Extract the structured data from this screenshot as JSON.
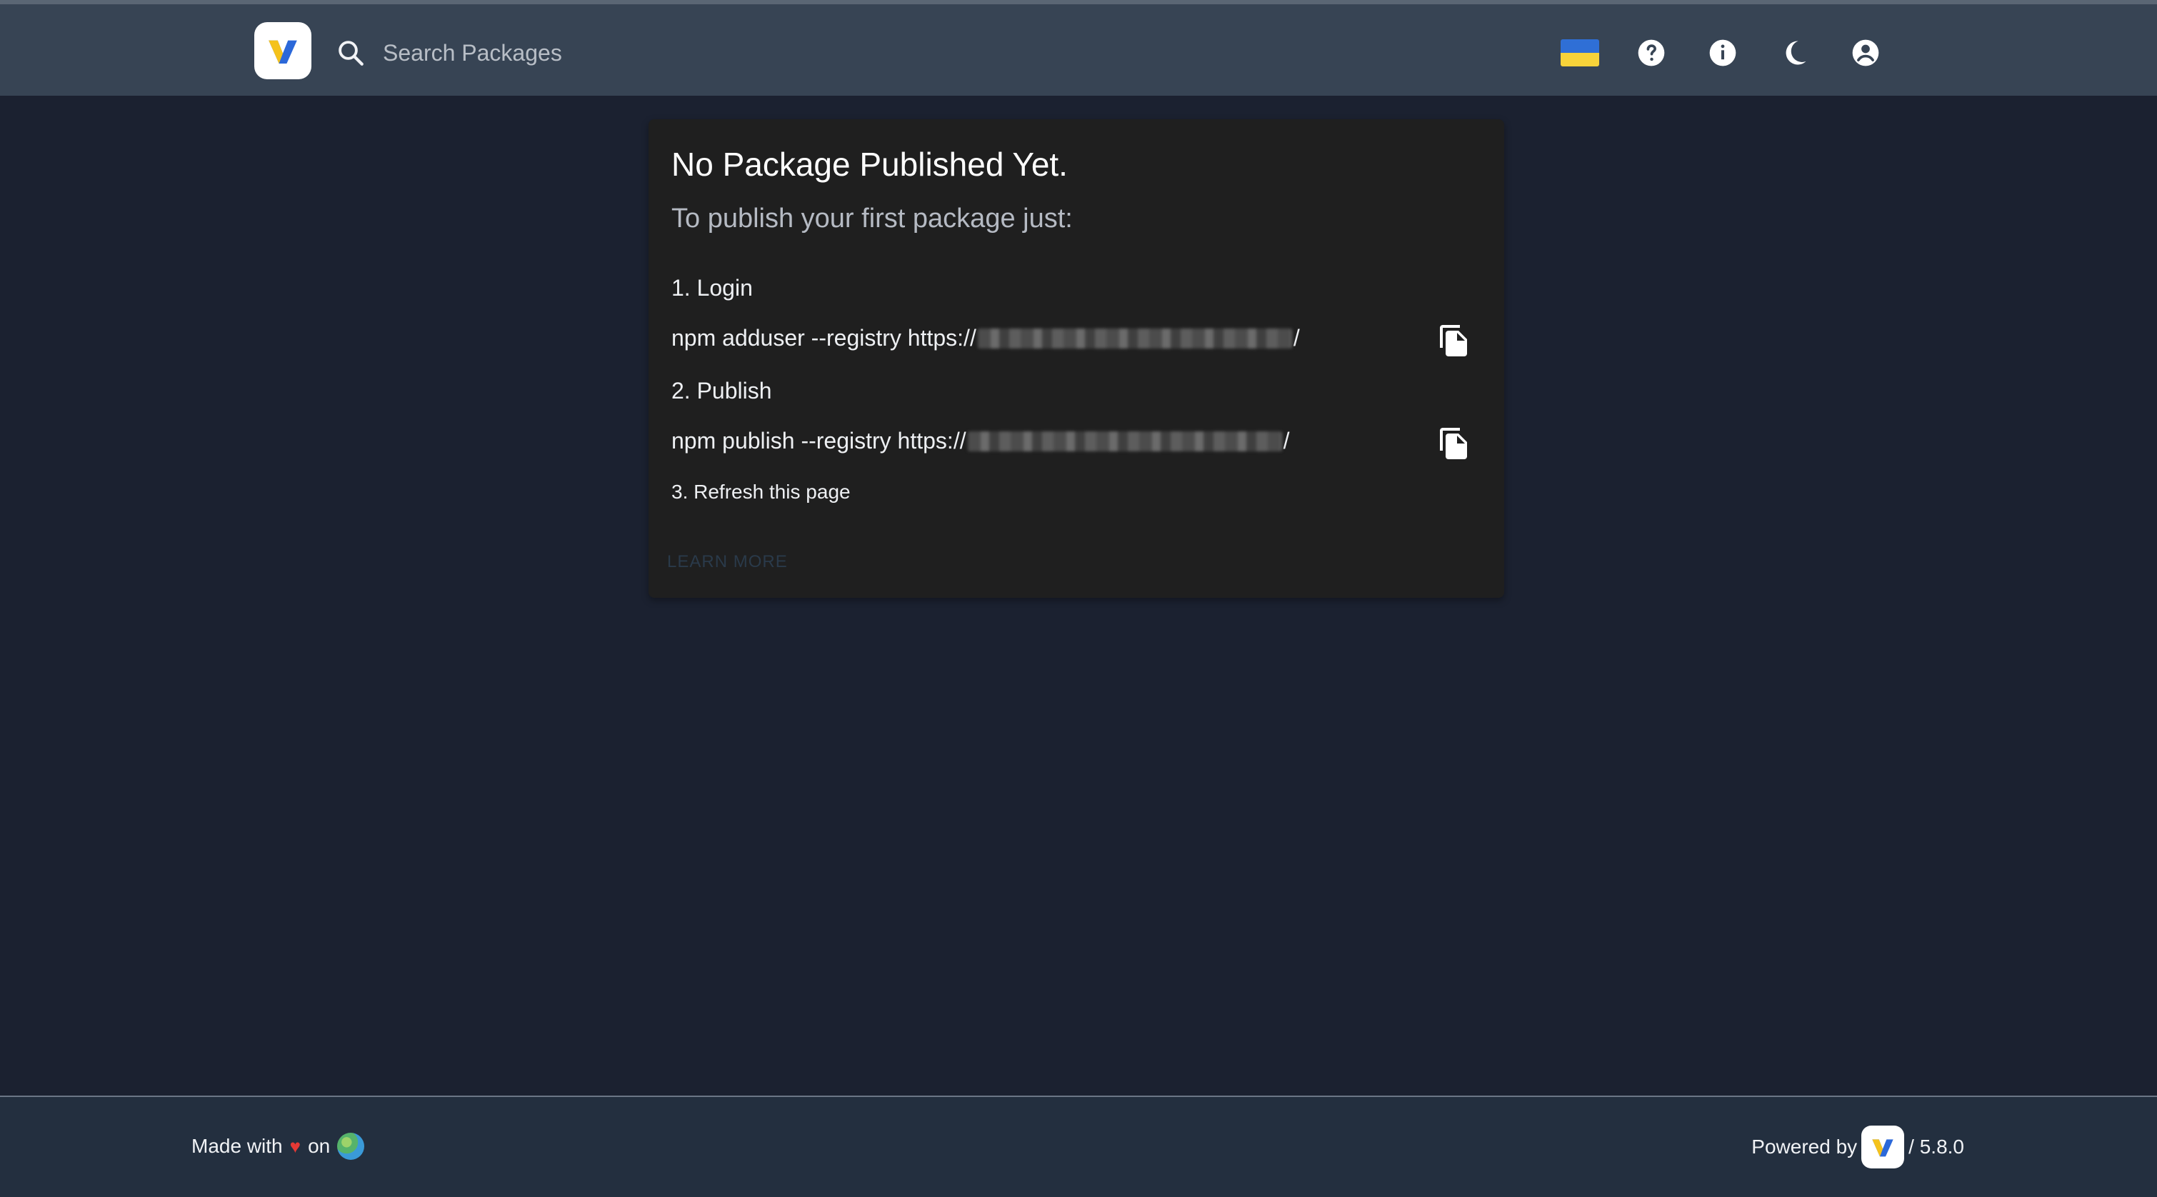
{
  "header": {
    "search_placeholder": "Search Packages",
    "actions": [
      {
        "name": "language-flag",
        "icon": "ukraine-flag-icon"
      },
      {
        "name": "help",
        "icon": "help-circle-icon"
      },
      {
        "name": "info",
        "icon": "info-icon"
      },
      {
        "name": "theme-toggle",
        "icon": "moon-icon"
      },
      {
        "name": "account",
        "icon": "account-circle-icon"
      }
    ]
  },
  "empty_state": {
    "title": "No Package Published Yet.",
    "subtitle": "To publish your first package just:",
    "step1_label": "1. Login",
    "step1_command_prefix": "npm adduser --registry https://",
    "step1_command_suffix": "/",
    "step2_label": "2. Publish",
    "step2_command_prefix": "npm publish --registry https://",
    "step2_command_suffix": "/",
    "step3_label": "3. Refresh this page",
    "learn_more": "LEARN MORE"
  },
  "footer": {
    "made_with": "Made with",
    "heart": "♥",
    "on": "on",
    "powered_by": "Powered by",
    "version": "/ 5.8.0"
  },
  "colors": {
    "topbar": "#374454",
    "background": "#1b2130",
    "card": "#1f1f1f",
    "footer": "#232f3f",
    "logo_yellow": "#f5c21b",
    "logo_blue": "#2b68d9"
  }
}
